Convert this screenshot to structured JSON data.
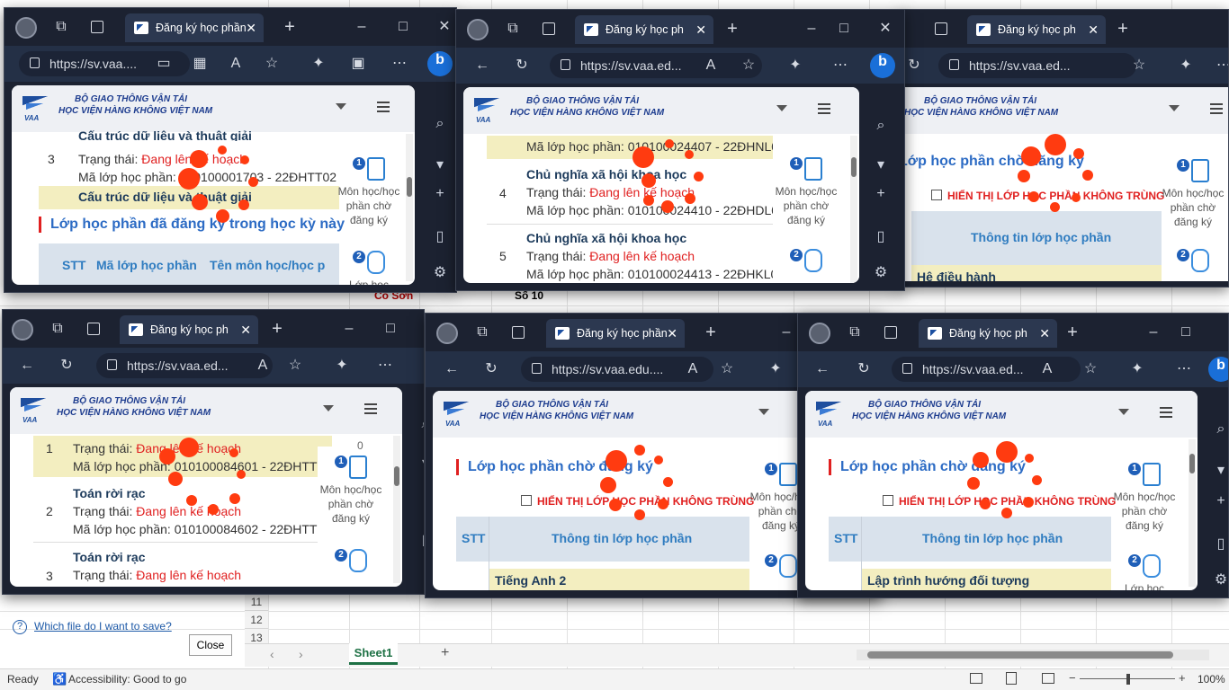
{
  "excel": {
    "cell_co_son": "Cô Sơn",
    "cell_so10": "Số 10",
    "row_numbers": [
      "11",
      "12",
      "13"
    ],
    "help_link": "Which file do I want to save?",
    "close_button": "Close",
    "sheet_tab": "Sheet1",
    "add_sheet": "+",
    "status_ready": "Ready",
    "status_accessibility": "Accessibility: Good to go",
    "zoom": "100%",
    "zoom_minus": "−",
    "zoom_plus": "+"
  },
  "browser": {
    "tab_title_full": "Đăng ký học phần",
    "tab_title_trunc": "Đăng ký học ph",
    "url_a": "https://sv.vaa....",
    "url_b": "https://sv.vaa.ed...",
    "url_c": "https://sv.vaa.edu....",
    "org_line1": "BỘ GIAO THÔNG VẬN TẢI",
    "org_line2": "HỌC VIỆN HÀNG KHÔNG VIỆT NAM",
    "logo_text": "VAA",
    "right_panel_badge1": "1",
    "right_panel_label": "Môn học/học phần chờ đăng ký",
    "right_panel_label_lines": [
      "Môn học/học",
      "phần chờ",
      "đăng ký"
    ],
    "right_panel_badge2": "2",
    "right_panel_label2": "Lớp học",
    "status_prefix": "Trạng thái: ",
    "status_value": "Đang lên kế hoạch",
    "code_prefix": "Mã lớp học phần: "
  },
  "win1": {
    "partial_title": "Cấu trúc dữ liệu và thuật giải",
    "row_no": "3",
    "code": "010100001703 - 22ĐHTT02",
    "highlight_name": "Cấu trúc dữ liệu và thuật giải",
    "section": "Lớp học phần đã đăng ký trong học kỳ này",
    "col_stt": "STT",
    "col_code": "Mã lớp học phần",
    "col_name": "Tên môn học/học p"
  },
  "win2": {
    "top_code": "010100024407 - 22ĐHNL01",
    "row4_no": "4",
    "row4_name": "Chủ nghĩa xã hội khoa học",
    "row4_code": "010100024410 - 22ĐHDL0",
    "row5_no": "5",
    "row5_name": "Chủ nghĩa xã hội khoa học",
    "row5_code": "010100024413 - 22ĐHKL0"
  },
  "win3": {
    "section": "Lớp học phần chờ đăng ký",
    "checkbox_label": "HIỂN THỊ LỚP HỌC PHẦN KHÔNG TRÙNG",
    "col_info": "Thông tin lớp học phần",
    "first_row": "Hệ điều hành"
  },
  "win4": {
    "row1_no": "1",
    "row1_code": "010100084601 - 22ĐHTT0",
    "row2_no": "2",
    "row2_name": "Toán rời rạc",
    "row2_code": "010100084602 - 22ĐHTT0",
    "row3_no": "3",
    "row3_name": "Toán rời rạc",
    "side_no": "0"
  },
  "win5": {
    "section": "Lớp học phần chờ đăng ký",
    "checkbox_label": "HIỂN THỊ LỚP HỌC PHẦN KHÔNG TRÙNG",
    "col_stt": "STT",
    "col_info": "Thông tin lớp học phần",
    "first_row": "Tiếng Anh 2"
  },
  "win6": {
    "section": "Lớp học phần chờ đăng ký",
    "checkbox_label": "HIỂN THỊ LỚP HỌC PHẦN KHÔNG TRÙNG",
    "col_stt": "STT",
    "col_info": "Thông tin lớp học phần",
    "first_row": "Lập trình hướng đối tượng"
  },
  "colors": {
    "chrome_dark": "#1c2231",
    "toolbar": "#243046",
    "status_red": "#e02020",
    "section_blue": "#2c6bc4",
    "highlight_yellow": "#f3eec0",
    "loading_dot": "#ff3b10"
  },
  "icons": [
    "avatar-icon",
    "workspaces-icon",
    "tab-actions-icon",
    "close-icon",
    "new-tab-icon",
    "minimize-icon",
    "maximize-icon",
    "back-icon",
    "refresh-icon",
    "lock-icon",
    "read-aloud-icon",
    "favorite-icon",
    "extensions-icon",
    "more-icon",
    "bing-icon",
    "search-icon",
    "plus-icon",
    "settings-icon",
    "hamburger-menu-icon",
    "chevron-down-icon",
    "document-icon",
    "backpack-icon"
  ]
}
